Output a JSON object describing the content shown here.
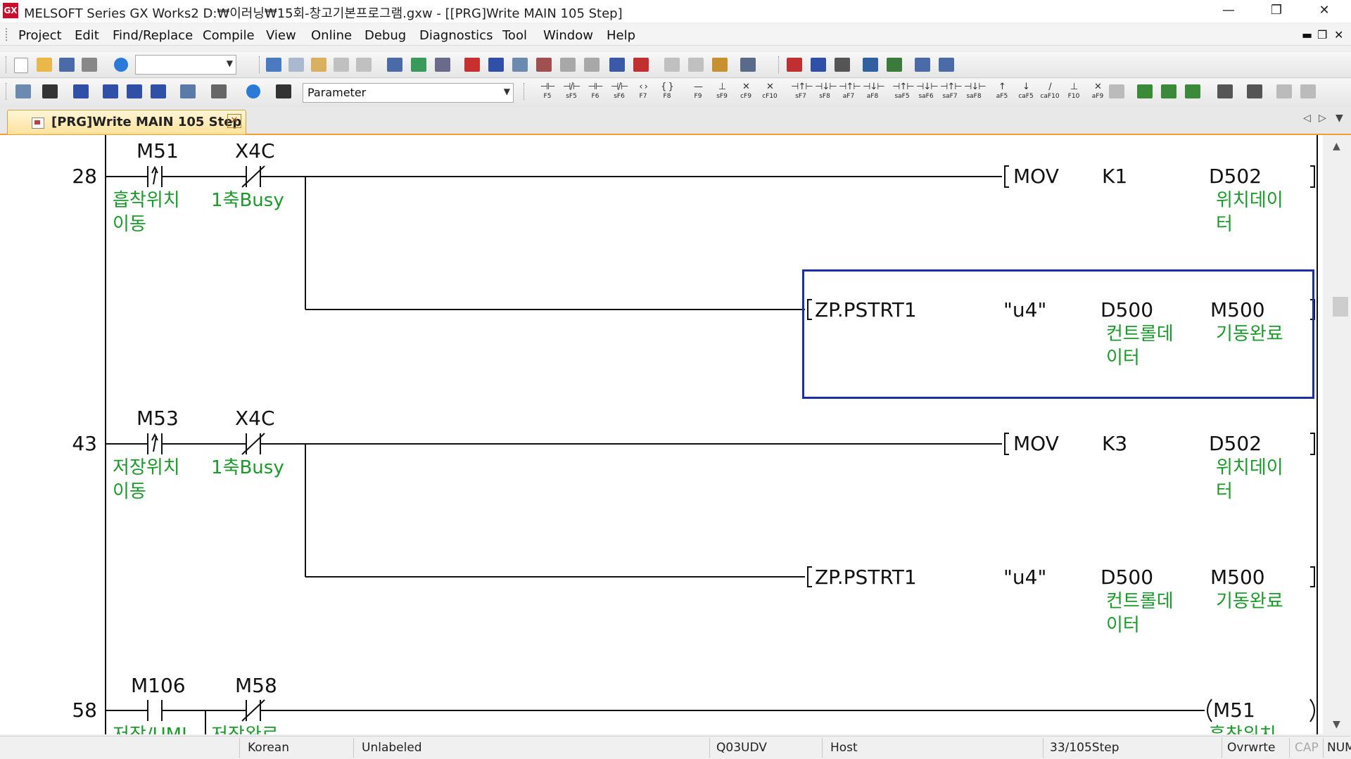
{
  "window": {
    "app_icon": "GX",
    "title": "MELSOFT Series GX Works2 D:₩이러닝₩15회-창고기본프로그램.gxw - [[PRG]Write MAIN 105 Step]",
    "minimize": "—",
    "restore": "❐",
    "close": "✕"
  },
  "menu": {
    "items": [
      "Project",
      "Edit",
      "Find/Replace",
      "Compile",
      "View",
      "Online",
      "Debug",
      "Diagnostics",
      "Tool",
      "Window",
      "Help"
    ],
    "mdi_min": "▬",
    "mdi_restore": "❐",
    "mdi_close": "✕"
  },
  "toolbar2": {
    "combo_value": "Parameter"
  },
  "fkeys": [
    {
      "sym": "⊣⊢",
      "label": "F5"
    },
    {
      "sym": "⊣/⊢",
      "label": "sF5"
    },
    {
      "sym": "⊣⊢",
      "label": "F6"
    },
    {
      "sym": "⊣/⊢",
      "label": "sF6"
    },
    {
      "sym": "‹ ›",
      "label": "F7"
    },
    {
      "sym": "{ }",
      "label": "F8"
    },
    {
      "sym": "—",
      "label": "F9"
    },
    {
      "sym": "⊥",
      "label": "sF9"
    },
    {
      "sym": "✕",
      "label": "cF9"
    },
    {
      "sym": "✕",
      "label": "cF10"
    },
    {
      "sym": "⊣↑⊢",
      "label": "sF7"
    },
    {
      "sym": "⊣↓⊢",
      "label": "sF8"
    },
    {
      "sym": "⊣↑⊢",
      "label": "aF7"
    },
    {
      "sym": "⊣↓⊢",
      "label": "aF8"
    },
    {
      "sym": "⊣↑⊢",
      "label": "saF5"
    },
    {
      "sym": "⊣↓⊢",
      "label": "saF6"
    },
    {
      "sym": "⊣↑⊢",
      "label": "saF7"
    },
    {
      "sym": "⊣↓⊢",
      "label": "saF8"
    },
    {
      "sym": "↑",
      "label": "aF5"
    },
    {
      "sym": "↓",
      "label": "caF5"
    },
    {
      "sym": "∕",
      "label": "caF10"
    },
    {
      "sym": "⊥",
      "label": "F10"
    },
    {
      "sym": "✕",
      "label": "aF9"
    }
  ],
  "tab": {
    "label": "[PRG]Write MAIN 105 Step",
    "close": "✕"
  },
  "ladder": {
    "rungs": [
      {
        "step": "28",
        "contacts": [
          {
            "device": "M51",
            "comment_lines": [
              "흡착위치",
              "이동"
            ]
          },
          {
            "device": "X4C",
            "comment_lines": [
              "1축Busy"
            ]
          }
        ],
        "instructions": [
          {
            "op": "MOV",
            "arg1": "K1",
            "arg2": "D502",
            "arg2_comment": [
              "위치데이",
              "터"
            ]
          },
          {
            "op": "ZP.PSTRT1",
            "arg1": "\"u4\"",
            "arg1b": "D500",
            "arg1b_comment": [
              "컨트롤데",
              "이터"
            ],
            "arg2": "M500",
            "arg2_comment": [
              "기동완료"
            ]
          }
        ]
      },
      {
        "step": "43",
        "contacts": [
          {
            "device": "M53",
            "comment_lines": [
              "저장위치",
              "이동"
            ]
          },
          {
            "device": "X4C",
            "comment_lines": [
              "1축Busy"
            ]
          }
        ],
        "instructions": [
          {
            "op": "MOV",
            "arg1": "K3",
            "arg2": "D502",
            "arg2_comment": [
              "위치데이",
              "터"
            ]
          },
          {
            "op": "ZP.PSTRT1",
            "arg1": "\"u4\"",
            "arg1b": "D500",
            "arg1b_comment": [
              "컨트롤데",
              "이터"
            ],
            "arg2": "M500",
            "arg2_comment": [
              "기동완료"
            ]
          }
        ]
      },
      {
        "step": "58",
        "contacts": [
          {
            "device": "M106",
            "comment_lines": [
              "저장/UML"
            ]
          },
          {
            "device": "M58",
            "comment_lines": [
              "저장완료"
            ]
          }
        ],
        "coil": {
          "device": "M51",
          "comment_lines": [
            "흡착위치"
          ]
        }
      }
    ]
  },
  "status": {
    "language": "Korean",
    "label_mode": "Unlabeled",
    "cpu": "Q03UDV",
    "connection": "Host",
    "step": "33/105Step",
    "mode": "Ovrwrte",
    "caps": "CAP",
    "num": "NUM"
  },
  "colors": {
    "comment": "#1a9a2a",
    "cursor": "#1a2ea8",
    "tab_accent": "#f0a030"
  }
}
